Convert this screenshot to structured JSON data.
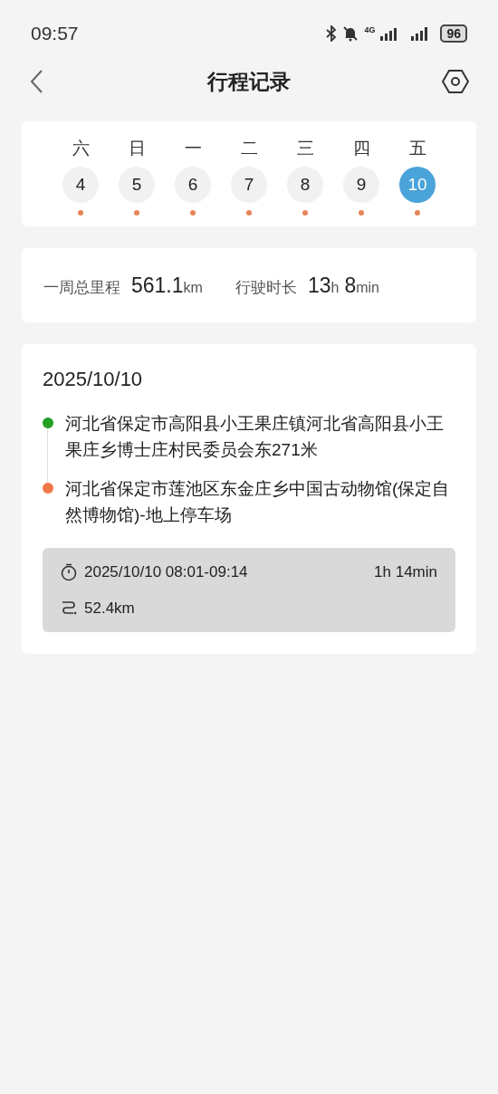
{
  "status_bar": {
    "time": "09:57",
    "network": "4G",
    "battery": "96"
  },
  "header": {
    "title": "行程记录"
  },
  "week": [
    {
      "weekday": "六",
      "date": "4",
      "selected": false,
      "has_trip": true
    },
    {
      "weekday": "日",
      "date": "5",
      "selected": false,
      "has_trip": true
    },
    {
      "weekday": "一",
      "date": "6",
      "selected": false,
      "has_trip": true
    },
    {
      "weekday": "二",
      "date": "7",
      "selected": false,
      "has_trip": true
    },
    {
      "weekday": "三",
      "date": "8",
      "selected": false,
      "has_trip": true
    },
    {
      "weekday": "四",
      "date": "9",
      "selected": false,
      "has_trip": true
    },
    {
      "weekday": "五",
      "date": "10",
      "selected": true,
      "has_trip": true
    }
  ],
  "summary": [
    {
      "label": "一周总里程",
      "parts": [
        {
          "number": "561.1",
          "unit": "km"
        }
      ]
    },
    {
      "label": "行驶时长",
      "parts": [
        {
          "number": "13",
          "unit": "h"
        },
        {
          "number": "8",
          "unit": "min"
        }
      ]
    }
  ],
  "trip": {
    "date": "2025/10/10",
    "stops": [
      {
        "address": "河北省保定市高阳县小王果庄镇河北省高阳县小王果庄乡博士庄村民委员会东271米",
        "color": "#22a022"
      },
      {
        "address": "河北省保定市莲池区东金庄乡中国古动物馆(保定自然博物馆)-地上停车场",
        "color": "#f07848"
      }
    ],
    "time_range": "2025/10/10 08:01-09:14",
    "duration": "1h 14min",
    "distance": "52.4km"
  }
}
